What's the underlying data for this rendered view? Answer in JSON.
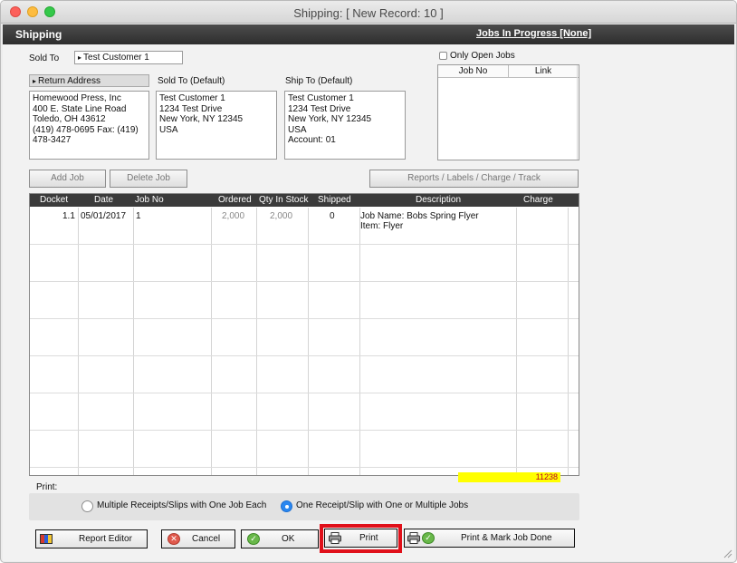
{
  "window": {
    "title": "Shipping:  [ New Record: 10 ]"
  },
  "header": {
    "title": "Shipping",
    "jobs_link": "Jobs In Progress [None]"
  },
  "sold_to": {
    "label": "Sold To",
    "value": "Test Customer 1"
  },
  "return_address": {
    "label": "Return Address",
    "text": "Homewood Press, Inc\n400 E. State Line Road\nToledo, OH  43612\n(419) 478-0695    Fax:  (419)\n478-3427"
  },
  "sold_to_default": {
    "label": "Sold To (Default)",
    "text": "Test Customer 1\n1234 Test Drive\nNew York, NY  12345\nUSA"
  },
  "ship_to_default": {
    "label": "Ship To (Default)",
    "text": "Test Customer 1\n1234 Test Drive\nNew York, NY  12345\nUSA\nAccount: 01"
  },
  "only_open_jobs": {
    "label": "Only Open Jobs",
    "checked": false
  },
  "jobs_table": {
    "columns": [
      "Job No",
      "Link"
    ]
  },
  "buttons": {
    "add_job": "Add Job",
    "delete_job": "Delete Job",
    "reports": "Reports / Labels / Charge / Track"
  },
  "grid": {
    "columns": [
      "Docket",
      "Date",
      "Job No",
      "Ordered",
      "Qty In Stock",
      "Shipped",
      "Description",
      "Charge"
    ],
    "rows": [
      {
        "docket": "1.1",
        "date": "05/01/2017",
        "job_no": "1",
        "ordered": "2,000",
        "qty_in_stock": "2,000",
        "shipped": "0",
        "desc_line1": "Job Name: Bobs Spring Flyer",
        "desc_line2": "Item: Flyer",
        "charge": ""
      }
    ]
  },
  "print": {
    "label": "Print:",
    "option_multiple": "Multiple Receipts/Slips with One Job Each",
    "option_one": "One Receipt/Slip with One or Multiple Jobs",
    "selected": "one"
  },
  "record_number": "11238",
  "footer": {
    "report_editor": "Report Editor",
    "cancel": "Cancel",
    "ok": "OK",
    "print": "Print",
    "print_mark_done": "Print  &  Mark Job Done"
  },
  "colors": {
    "header": "#3b3b3b",
    "highlight_outline": "#e0101a",
    "yellow": "#ffff00",
    "radio_selected": "#2a87f0"
  }
}
